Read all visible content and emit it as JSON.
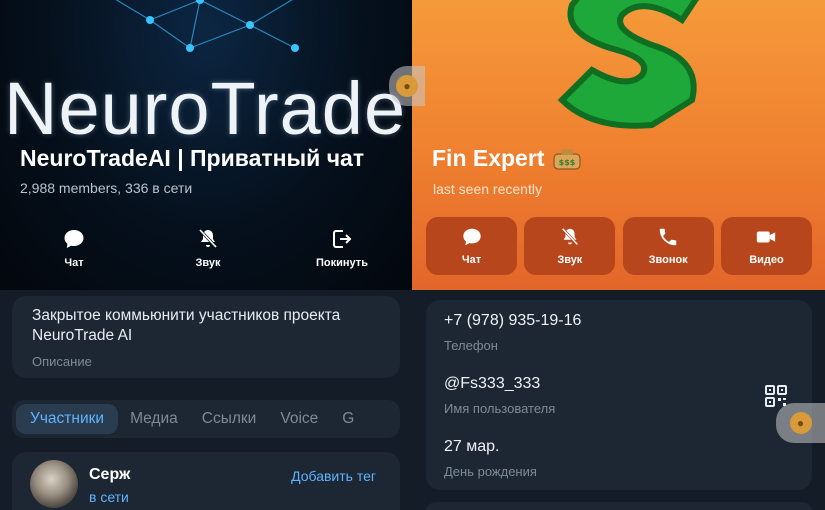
{
  "left_panel": {
    "logo_text": "NeuroTrade",
    "title": "NeuroTradeAI | Приватный чат",
    "subtitle": "2,988 members, 336 в сети",
    "actions": [
      {
        "label": "Чат",
        "icon": "chat-bubble-icon"
      },
      {
        "label": "Звук",
        "icon": "bell-muted-icon"
      },
      {
        "label": "Покинуть",
        "icon": "logout-icon"
      }
    ],
    "description": {
      "text": "Закрытое коммьюнити участников проекта NeuroTrade AI",
      "label": "Описание"
    },
    "tabs": [
      {
        "label": "Участники",
        "active": true
      },
      {
        "label": "Медиа",
        "active": false
      },
      {
        "label": "Ссылки",
        "active": false
      },
      {
        "label": "Voice",
        "active": false
      },
      {
        "label": "G",
        "active": false
      }
    ],
    "member": {
      "name": "Серж",
      "status": "в сети",
      "tag_action": "Добавить тег"
    }
  },
  "right_panel": {
    "title": "Fin Expert",
    "title_emoji": "money-bag-icon",
    "subtitle": "last seen recently",
    "actions": [
      {
        "label": "Чат",
        "icon": "chat-bubble-icon"
      },
      {
        "label": "Звук",
        "icon": "bell-muted-icon"
      },
      {
        "label": "Звонок",
        "icon": "phone-icon"
      },
      {
        "label": "Видео",
        "icon": "video-camera-icon"
      }
    ],
    "info": {
      "phone": {
        "value": "+7 (978) 935-19-16",
        "label": "Телефон"
      },
      "username": {
        "value": "@Fs333_333",
        "label": "Имя пользователя"
      },
      "birthday": {
        "value": "27 мар.",
        "label": "День рождения"
      }
    }
  },
  "colors": {
    "accent_blue": "#5fb3ff",
    "card_bg": "#1c2733",
    "orange_header": "#ef7f2f",
    "orange_button": "#b8461d"
  }
}
